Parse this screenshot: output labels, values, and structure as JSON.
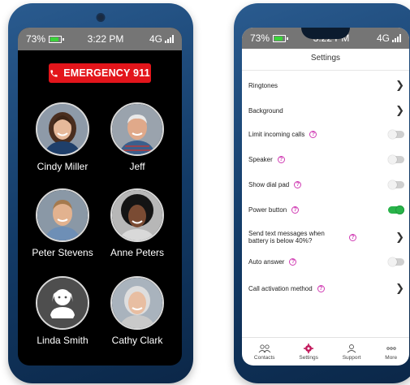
{
  "status": {
    "battery": "73%",
    "time": "3:22 PM",
    "network": "4G"
  },
  "emergency": {
    "label": "EMERGENCY 911"
  },
  "contacts": [
    {
      "name": "Cindy Miller"
    },
    {
      "name": "Jeff"
    },
    {
      "name": "Peter Stevens"
    },
    {
      "name": "Anne Peters"
    },
    {
      "name": "Linda Smith"
    },
    {
      "name": "Cathy Clark"
    }
  ],
  "settings": {
    "title": "Settings",
    "rows": [
      {
        "label": "Ringtones",
        "control": "chevron"
      },
      {
        "label": "Background",
        "control": "chevron"
      },
      {
        "label": "Limit incoming calls",
        "control": "toggle",
        "on": false,
        "help": true
      },
      {
        "label": "Speaker",
        "control": "toggle",
        "on": false,
        "help": true
      },
      {
        "label": "Show dial pad",
        "control": "toggle",
        "on": false,
        "help": true
      },
      {
        "label": "Power button",
        "control": "toggle",
        "on": true,
        "help": true
      },
      {
        "label": "Send text messages when battery is below 40%?",
        "control": "chevron",
        "help": true
      },
      {
        "label": "Auto answer",
        "control": "toggle",
        "on": false,
        "help": true
      },
      {
        "label": "Call activation method",
        "control": "chevron",
        "help": true
      }
    ]
  },
  "tabs": [
    {
      "label": "Contacts",
      "icon": "contacts-icon"
    },
    {
      "label": "Settings",
      "icon": "gear-icon"
    },
    {
      "label": "Support",
      "icon": "support-icon"
    },
    {
      "label": "More",
      "icon": "more-icon"
    }
  ],
  "colors": {
    "emergency": "#e3151b",
    "toggle_on": "#29b34a",
    "help": "#d03bb3",
    "settings_tab": "#c2185b"
  }
}
